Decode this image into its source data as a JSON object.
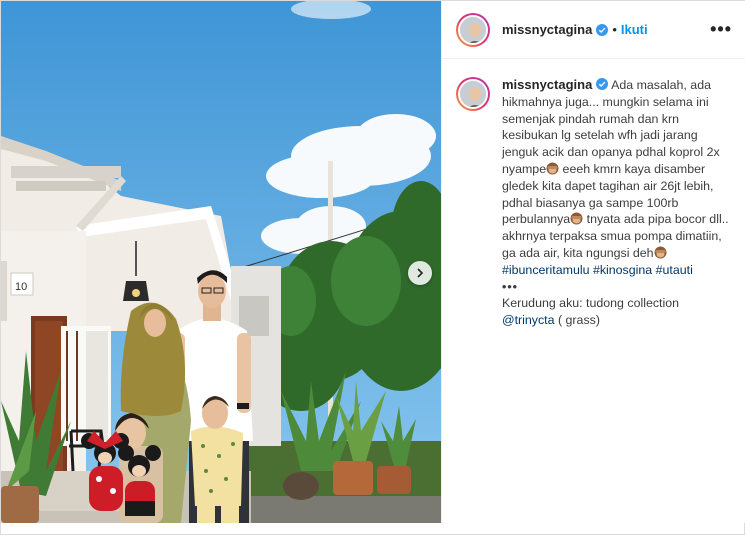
{
  "post": {
    "username": "missnyctagina",
    "separator": "•",
    "follow_label": "Ikuti",
    "more_label": "•••",
    "caption": {
      "lines": [
        "Ada masalah, ada",
        "hikmahnya juga... mungkin selama ini",
        "semenjak pindah rumah dan krn",
        "kesibukan lg setelah wfh jadi jarang",
        "jenguk acik dan opanya pdhal koprol",
        "2x nyampe",
        "eeeh kmrn kaya",
        "disamber gledek kita dapet tagihan air",
        "26jt lebih, pdhal biasanya ga sampe",
        "100rb perbulannya",
        "tnyata ada pipa",
        "bocor dll.. akhrnya terpaksa smua",
        "pompa dimatiin, ga ada air, kita",
        "ngungsi deh"
      ],
      "hashtags": [
        "#ibunceritamulu",
        "#kinosgina",
        "#utauti"
      ],
      "more": "•••",
      "credit_text": "Kerudung aku: tudong collection",
      "credit_mention": "@trinycta",
      "credit_suffix": "( grass)"
    },
    "photo": {
      "house_number": "10"
    }
  }
}
